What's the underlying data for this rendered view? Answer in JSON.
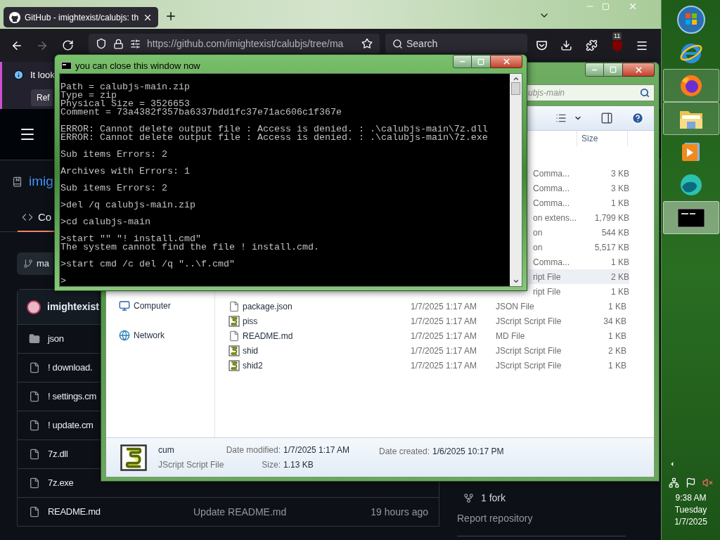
{
  "browser": {
    "tab": {
      "title": "GitHub - imightexist/calubjs: th",
      "selected": true
    },
    "url": "https://github.com/imightexist/calubjs/tree/ma",
    "search": {
      "placeholder": "Search"
    },
    "extension_badge": "11",
    "banner": {
      "text": "It look",
      "button": "Ref"
    },
    "repo_name": "imig",
    "tabs": [
      {
        "label": "Co",
        "selected": true
      }
    ],
    "branch": "ma",
    "owner": "imightexist",
    "files": [
      {
        "kind": "folder",
        "name": "json"
      },
      {
        "kind": "file",
        "name": "! download."
      },
      {
        "kind": "file",
        "name": "! settings.cm"
      },
      {
        "kind": "file",
        "name": "! update.cm"
      },
      {
        "kind": "file",
        "name": "7z.dll"
      },
      {
        "kind": "file",
        "name": "7z.exe"
      },
      {
        "kind": "file",
        "name": "README.md",
        "message": "Update README.md",
        "time": "19 hours ago"
      }
    ],
    "about": {
      "forks": "1 fork",
      "report": "Report repository"
    }
  },
  "explorer": {
    "search": {
      "placeholder": "ubjs-main"
    },
    "columns": [
      {
        "label": "Size"
      }
    ],
    "nav": [
      {
        "kind": "computer",
        "label": "Computer"
      },
      {
        "kind": "network",
        "label": "Network"
      }
    ],
    "rows": [
      {
        "kind": "partial",
        "type": "Comma...",
        "size": "3 KB",
        "hovered": false
      },
      {
        "kind": "partial",
        "type": "Comma...",
        "size": "3 KB",
        "hovered": false
      },
      {
        "kind": "partial",
        "type": "Comma...",
        "size": "1 KB",
        "hovered": false
      },
      {
        "kind": "partial",
        "type": "on extens...",
        "size": "1,799 KB",
        "hovered": false
      },
      {
        "kind": "partial",
        "type": "on",
        "size": "544 KB",
        "hovered": false
      },
      {
        "kind": "partial",
        "type": "on",
        "size": "5,517 KB",
        "hovered": false
      },
      {
        "kind": "partial",
        "type": "Comma...",
        "size": "1 KB",
        "hovered": false
      },
      {
        "kind": "partial",
        "type": "ript File",
        "size": "2 KB",
        "hovered": true
      },
      {
        "kind": "partial",
        "type": "ript File",
        "size": "1 KB",
        "hovered": false
      },
      {
        "kind": "text",
        "name": "package.json",
        "date": "1/7/2025 1:17 AM",
        "type": "JSON File",
        "size": "1 KB",
        "hovered": false
      },
      {
        "kind": "script",
        "name": "piss",
        "date": "1/7/2025 1:17 AM",
        "type": "JScript Script File",
        "size": "34 KB",
        "hovered": false
      },
      {
        "kind": "text",
        "name": "README.md",
        "date": "1/7/2025 1:17 AM",
        "type": "MD File",
        "size": "1 KB",
        "hovered": false
      },
      {
        "kind": "script",
        "name": "shid",
        "date": "1/7/2025 1:17 AM",
        "type": "JScript Script File",
        "size": "2 KB",
        "hovered": false
      },
      {
        "kind": "script",
        "name": "shid2",
        "date": "1/7/2025 1:17 AM",
        "type": "JScript Script File",
        "size": "1 KB",
        "hovered": false
      }
    ],
    "details": {
      "name": "cum",
      "type": "JScript Script File",
      "modified_label": "Date modified:",
      "modified": "1/7/2025 1:17 AM",
      "size_label": "Size:",
      "size": "1.13 KB",
      "created_label": "Date created:",
      "created": "1/6/2025 10:17 PM"
    }
  },
  "console": {
    "title": "you can close this window now",
    "paragraphs": [
      [
        "Path = calubjs-main.zip",
        "Type = zip",
        "Physical Size = 3526653",
        "Comment = 73a4382f357ba6337bdd1fc37e71ac606c1f367e"
      ],
      [
        "ERROR: Cannot delete output file : Access is denied. : .\\calubjs-main\\7z.dll",
        "ERROR: Cannot delete output file : Access is denied. : .\\calubjs-main\\7z.exe"
      ],
      [
        "Sub items Errors: 2"
      ],
      [
        "Archives with Errors: 1"
      ],
      [
        "Sub items Errors: 2"
      ],
      [
        ">del /q calubjs-main.zip"
      ],
      [
        ">cd calubjs-main"
      ],
      [
        ">start \"\" \"! install.cmd\"",
        "The system cannot find the file ! install.cmd."
      ],
      [
        ">start cmd /c del /q \"..\\f.cmd\""
      ],
      [
        ">"
      ]
    ]
  },
  "taskbar": {
    "items": [
      {
        "kind": "start",
        "open": false,
        "selected": false
      },
      {
        "kind": "ie",
        "open": false,
        "selected": false
      },
      {
        "kind": "firefox",
        "open": true,
        "selected": false
      },
      {
        "kind": "folder",
        "open": true,
        "selected": false
      },
      {
        "kind": "media",
        "open": false,
        "selected": false
      },
      {
        "kind": "edge",
        "open": false,
        "selected": false
      },
      {
        "kind": "cmd",
        "open": true,
        "selected": true
      }
    ],
    "clock": {
      "time": "9:38 AM",
      "day": "Tuesday",
      "date": "1/7/2025"
    }
  }
}
